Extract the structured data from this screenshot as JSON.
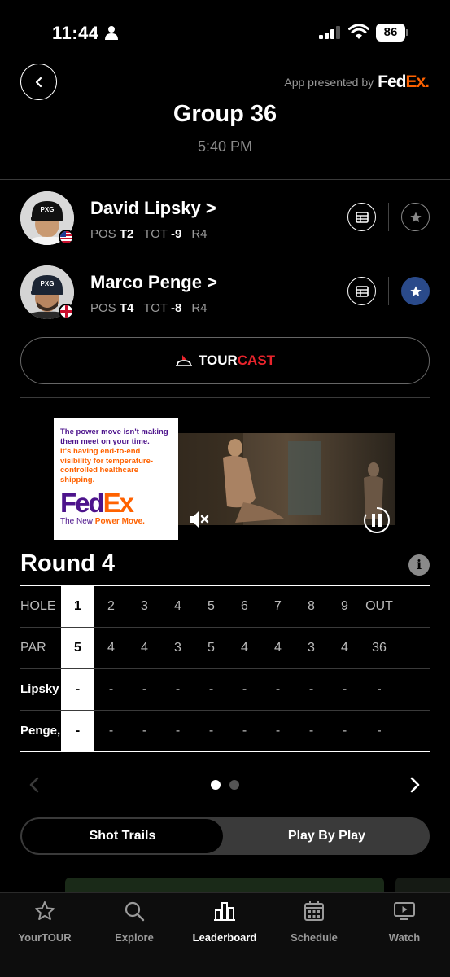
{
  "status_bar": {
    "time": "11:44",
    "battery": "86"
  },
  "header": {
    "sponsor_text": "App presented by",
    "sponsor_logo": {
      "fed": "Fed",
      "ex": "Ex",
      "dot": "."
    },
    "title": "Group 36",
    "subtitle": "5:40 PM"
  },
  "players": [
    {
      "name": "David Lipsky",
      "chevron": ">",
      "pos_label": "POS",
      "pos": "T2",
      "tot_label": "TOT",
      "tot": "-9",
      "round": "R4",
      "flag": "usa",
      "favorite": false
    },
    {
      "name": "Marco Penge",
      "chevron": ">",
      "pos_label": "POS",
      "pos": "T4",
      "tot_label": "TOT",
      "tot": "-8",
      "round": "R4",
      "flag": "england",
      "favorite": true
    }
  ],
  "tourcast": {
    "tour": "TOUR",
    "cast": "CAST"
  },
  "ad": {
    "line1": "The power move isn't making them meet on your time.",
    "line2": "It's having end-to-end visibility for temperature-controlled healthcare shipping.",
    "logo_fed": "Fed",
    "logo_ex": "Ex",
    "tag_prefix": "The New ",
    "tag_highlight": "Power Move."
  },
  "round": {
    "title": "Round 4",
    "info": "i",
    "hole_label": "HOLE",
    "par_label": "PAR",
    "holes": [
      "1",
      "2",
      "3",
      "4",
      "5",
      "6",
      "7",
      "8",
      "9",
      "OUT"
    ],
    "pars": [
      "5",
      "4",
      "4",
      "3",
      "5",
      "4",
      "4",
      "3",
      "4",
      "36"
    ],
    "player_rows": [
      {
        "label": "Lipsky",
        "scores": [
          "-",
          "-",
          "-",
          "-",
          "-",
          "-",
          "-",
          "-",
          "-",
          "-"
        ]
      },
      {
        "label": "Penge,",
        "scores": [
          "-",
          "-",
          "-",
          "-",
          "-",
          "-",
          "-",
          "-",
          "-",
          "-"
        ]
      }
    ],
    "current_hole_index": 0
  },
  "pager": {
    "pages": 2,
    "current": 0
  },
  "toggle": {
    "left": "Shot Trails",
    "right": "Play By Play",
    "selected": "left"
  },
  "tabs": [
    {
      "label": "YourTOUR",
      "icon": "star-icon"
    },
    {
      "label": "Explore",
      "icon": "search-icon"
    },
    {
      "label": "Leaderboard",
      "icon": "bar-chart-icon"
    },
    {
      "label": "Schedule",
      "icon": "calendar-icon"
    },
    {
      "label": "Watch",
      "icon": "play-screen-icon"
    }
  ],
  "active_tab": 2,
  "colors": {
    "fedex_orange": "#ff6200",
    "fedex_purple": "#4d148c",
    "tourcast_red": "#e8242c",
    "favorite_blue": "#2a4a8a"
  }
}
